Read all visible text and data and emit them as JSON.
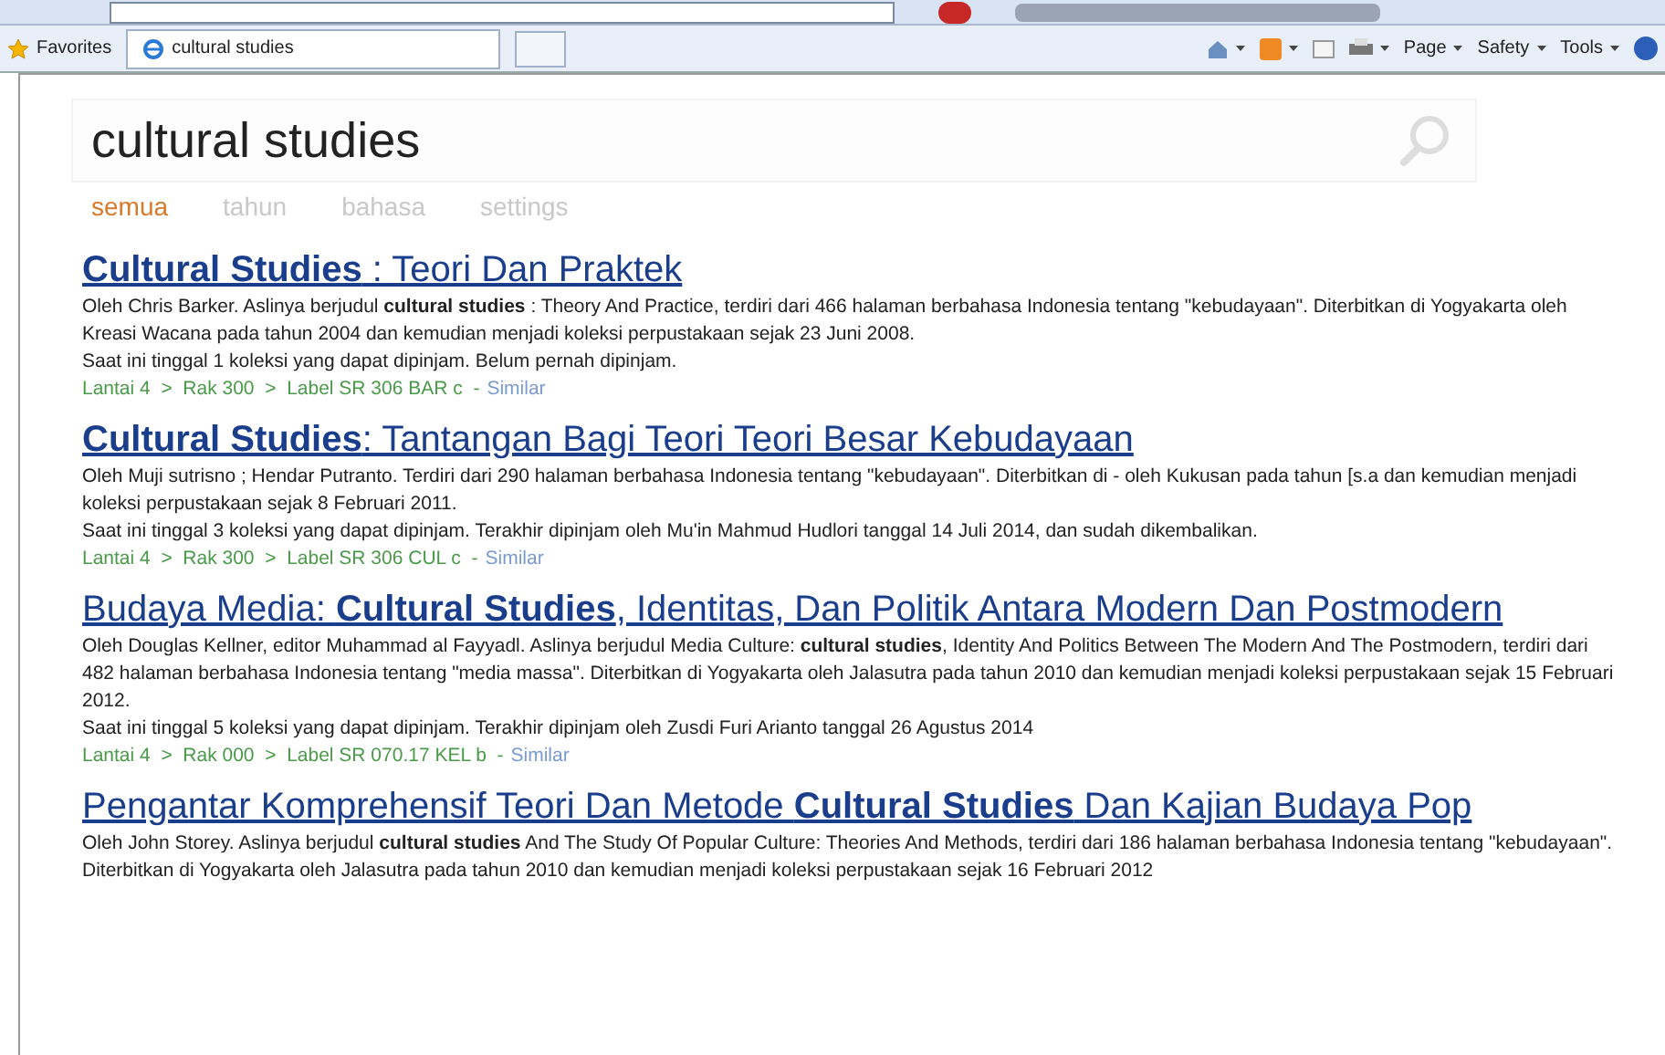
{
  "favorites_bar": {
    "favorites": "Favorites",
    "tab": {
      "label": "cultural studies",
      "selected": true
    },
    "commands": [
      "Page",
      "Safety",
      "Tools"
    ]
  },
  "search": {
    "value": "cultural studies"
  },
  "filters": [
    {
      "label": "semua",
      "selected": true
    },
    {
      "label": "tahun",
      "selected": false
    },
    {
      "label": "bahasa",
      "selected": false
    },
    {
      "label": "settings",
      "selected": false
    }
  ],
  "results": [
    {
      "title": "**Cultural Studies** : Teori Dan Praktek",
      "description": "Oleh Chris Barker. Aslinya berjudul **cultural studies** : Theory And Practice, terdiri dari 466 halaman berbahasa Indonesia tentang \"kebudayaan\". Diterbitkan di Yogyakarta oleh Kreasi Wacana pada tahun 2004 dan kemudian menjadi koleksi perpustakaan sejak 23 Juni 2008.",
      "availability": "Saat ini tinggal 1 koleksi yang dapat dipinjam. Belum pernah dipinjam.",
      "location": "Lantai 4  >  Rak 300  >  Label SR 306 BAR c  -",
      "similar": "Similar"
    },
    {
      "title": "**Cultural Studies**: Tantangan Bagi Teori Teori Besar Kebudayaan",
      "description": "Oleh Muji sutrisno ; Hendar Putranto. Terdiri dari 290 halaman berbahasa Indonesia tentang \"kebudayaan\". Diterbitkan di - oleh Kukusan pada tahun [s.a dan kemudian menjadi koleksi perpustakaan sejak 8 Februari 2011.",
      "availability": "Saat ini tinggal 3 koleksi yang dapat dipinjam. Terakhir dipinjam oleh Mu'in Mahmud Hudlori tanggal 14 Juli 2014, dan sudah dikembalikan.",
      "location": "Lantai 4  >  Rak 300  >  Label SR 306 CUL c  -",
      "similar": "Similar"
    },
    {
      "title": "Budaya Media: **Cultural Studies**, Identitas, Dan Politik Antara Modern Dan Postmodern",
      "description": "Oleh Douglas Kellner, editor Muhammad al Fayyadl. Aslinya berjudul Media Culture: **cultural studies**, Identity And Politics Between The Modern And The Postmodern, terdiri dari 482 halaman berbahasa Indonesia tentang \"media massa\". Diterbitkan di Yogyakarta oleh Jalasutra pada tahun 2010 dan kemudian menjadi koleksi perpustakaan sejak 15 Februari 2012.",
      "availability": "Saat ini tinggal 5 koleksi yang dapat dipinjam. Terakhir dipinjam oleh Zusdi Furi Arianto tanggal 26 Agustus 2014",
      "location": "Lantai 4  >  Rak 000  >  Label SR 070.17 KEL b  -",
      "similar": "Similar"
    },
    {
      "title": "Pengantar Komprehensif Teori Dan Metode **Cultural Studies** Dan Kajian Budaya Pop",
      "description": "Oleh John Storey. Aslinya berjudul **cultural studies** And The Study Of Popular Culture: Theories And Methods, terdiri dari 186 halaman berbahasa Indonesia tentang \"kebudayaan\". Diterbitkan di Yogyakarta oleh Jalasutra pada tahun 2010 dan kemudian menjadi koleksi perpustakaan sejak 16 Februari 2012"
    }
  ]
}
